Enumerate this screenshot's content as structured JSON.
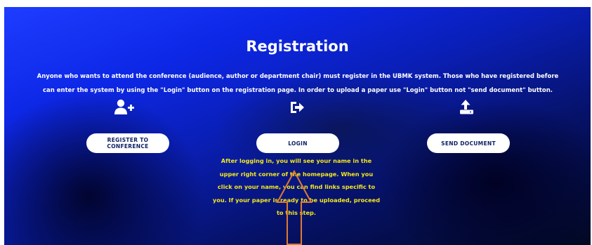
{
  "page": {
    "title": "Registration",
    "description": "Anyone who wants to attend the conference (audience, author or department chair) must register in the UBMK system. Those who have registered before can enter the system by using the \"Login\" button on the registration page. In order to upload a paper use \"Login\" button not \"send document\" button."
  },
  "actions": [
    {
      "icon": "add-user-icon",
      "label": "REGISTER TO CONFERENCE"
    },
    {
      "icon": "sign-in-icon",
      "label": "LOGIN"
    },
    {
      "icon": "upload-icon",
      "label": "SEND DOCUMENT"
    }
  ],
  "annotation": {
    "text": "After logging in, you will see your name in the upper right corner of the homepage. When you click on your name, you can find links specific to you. If your paper is ready to be uploaded, proceed to this step.",
    "color": "#f4e71b",
    "arrow_color": "#e07a2e",
    "arrow_direction": "up"
  },
  "colors": {
    "background": "#0d27e6",
    "button_bg": "#ffffff",
    "button_text": "#0b1f63"
  }
}
